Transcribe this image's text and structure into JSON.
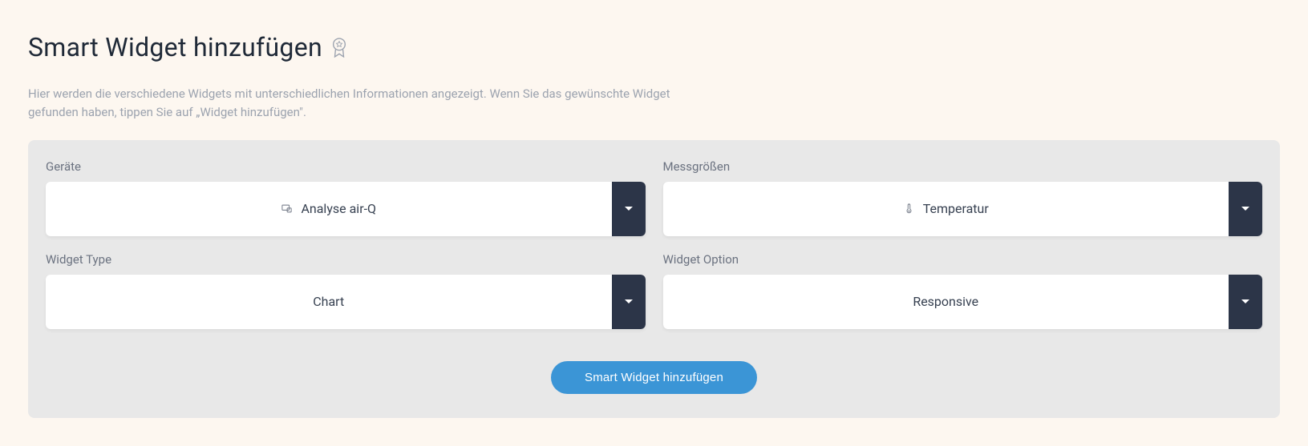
{
  "header": {
    "title": "Smart Widget hinzufügen"
  },
  "description": "Hier werden die verschiedene Widgets mit unterschiedlichen Informationen angezeigt. Wenn Sie das gewünschte Widget gefunden haben, tippen Sie auf „Widget hinzufügen\".",
  "form": {
    "devices": {
      "label": "Geräte",
      "value": "Analyse air-Q"
    },
    "measurements": {
      "label": "Messgrößen",
      "value": "Temperatur"
    },
    "widget_type": {
      "label": "Widget Type",
      "value": "Chart"
    },
    "widget_option": {
      "label": "Widget Option",
      "value": "Responsive"
    }
  },
  "actions": {
    "submit_label": "Smart Widget hinzufügen"
  }
}
